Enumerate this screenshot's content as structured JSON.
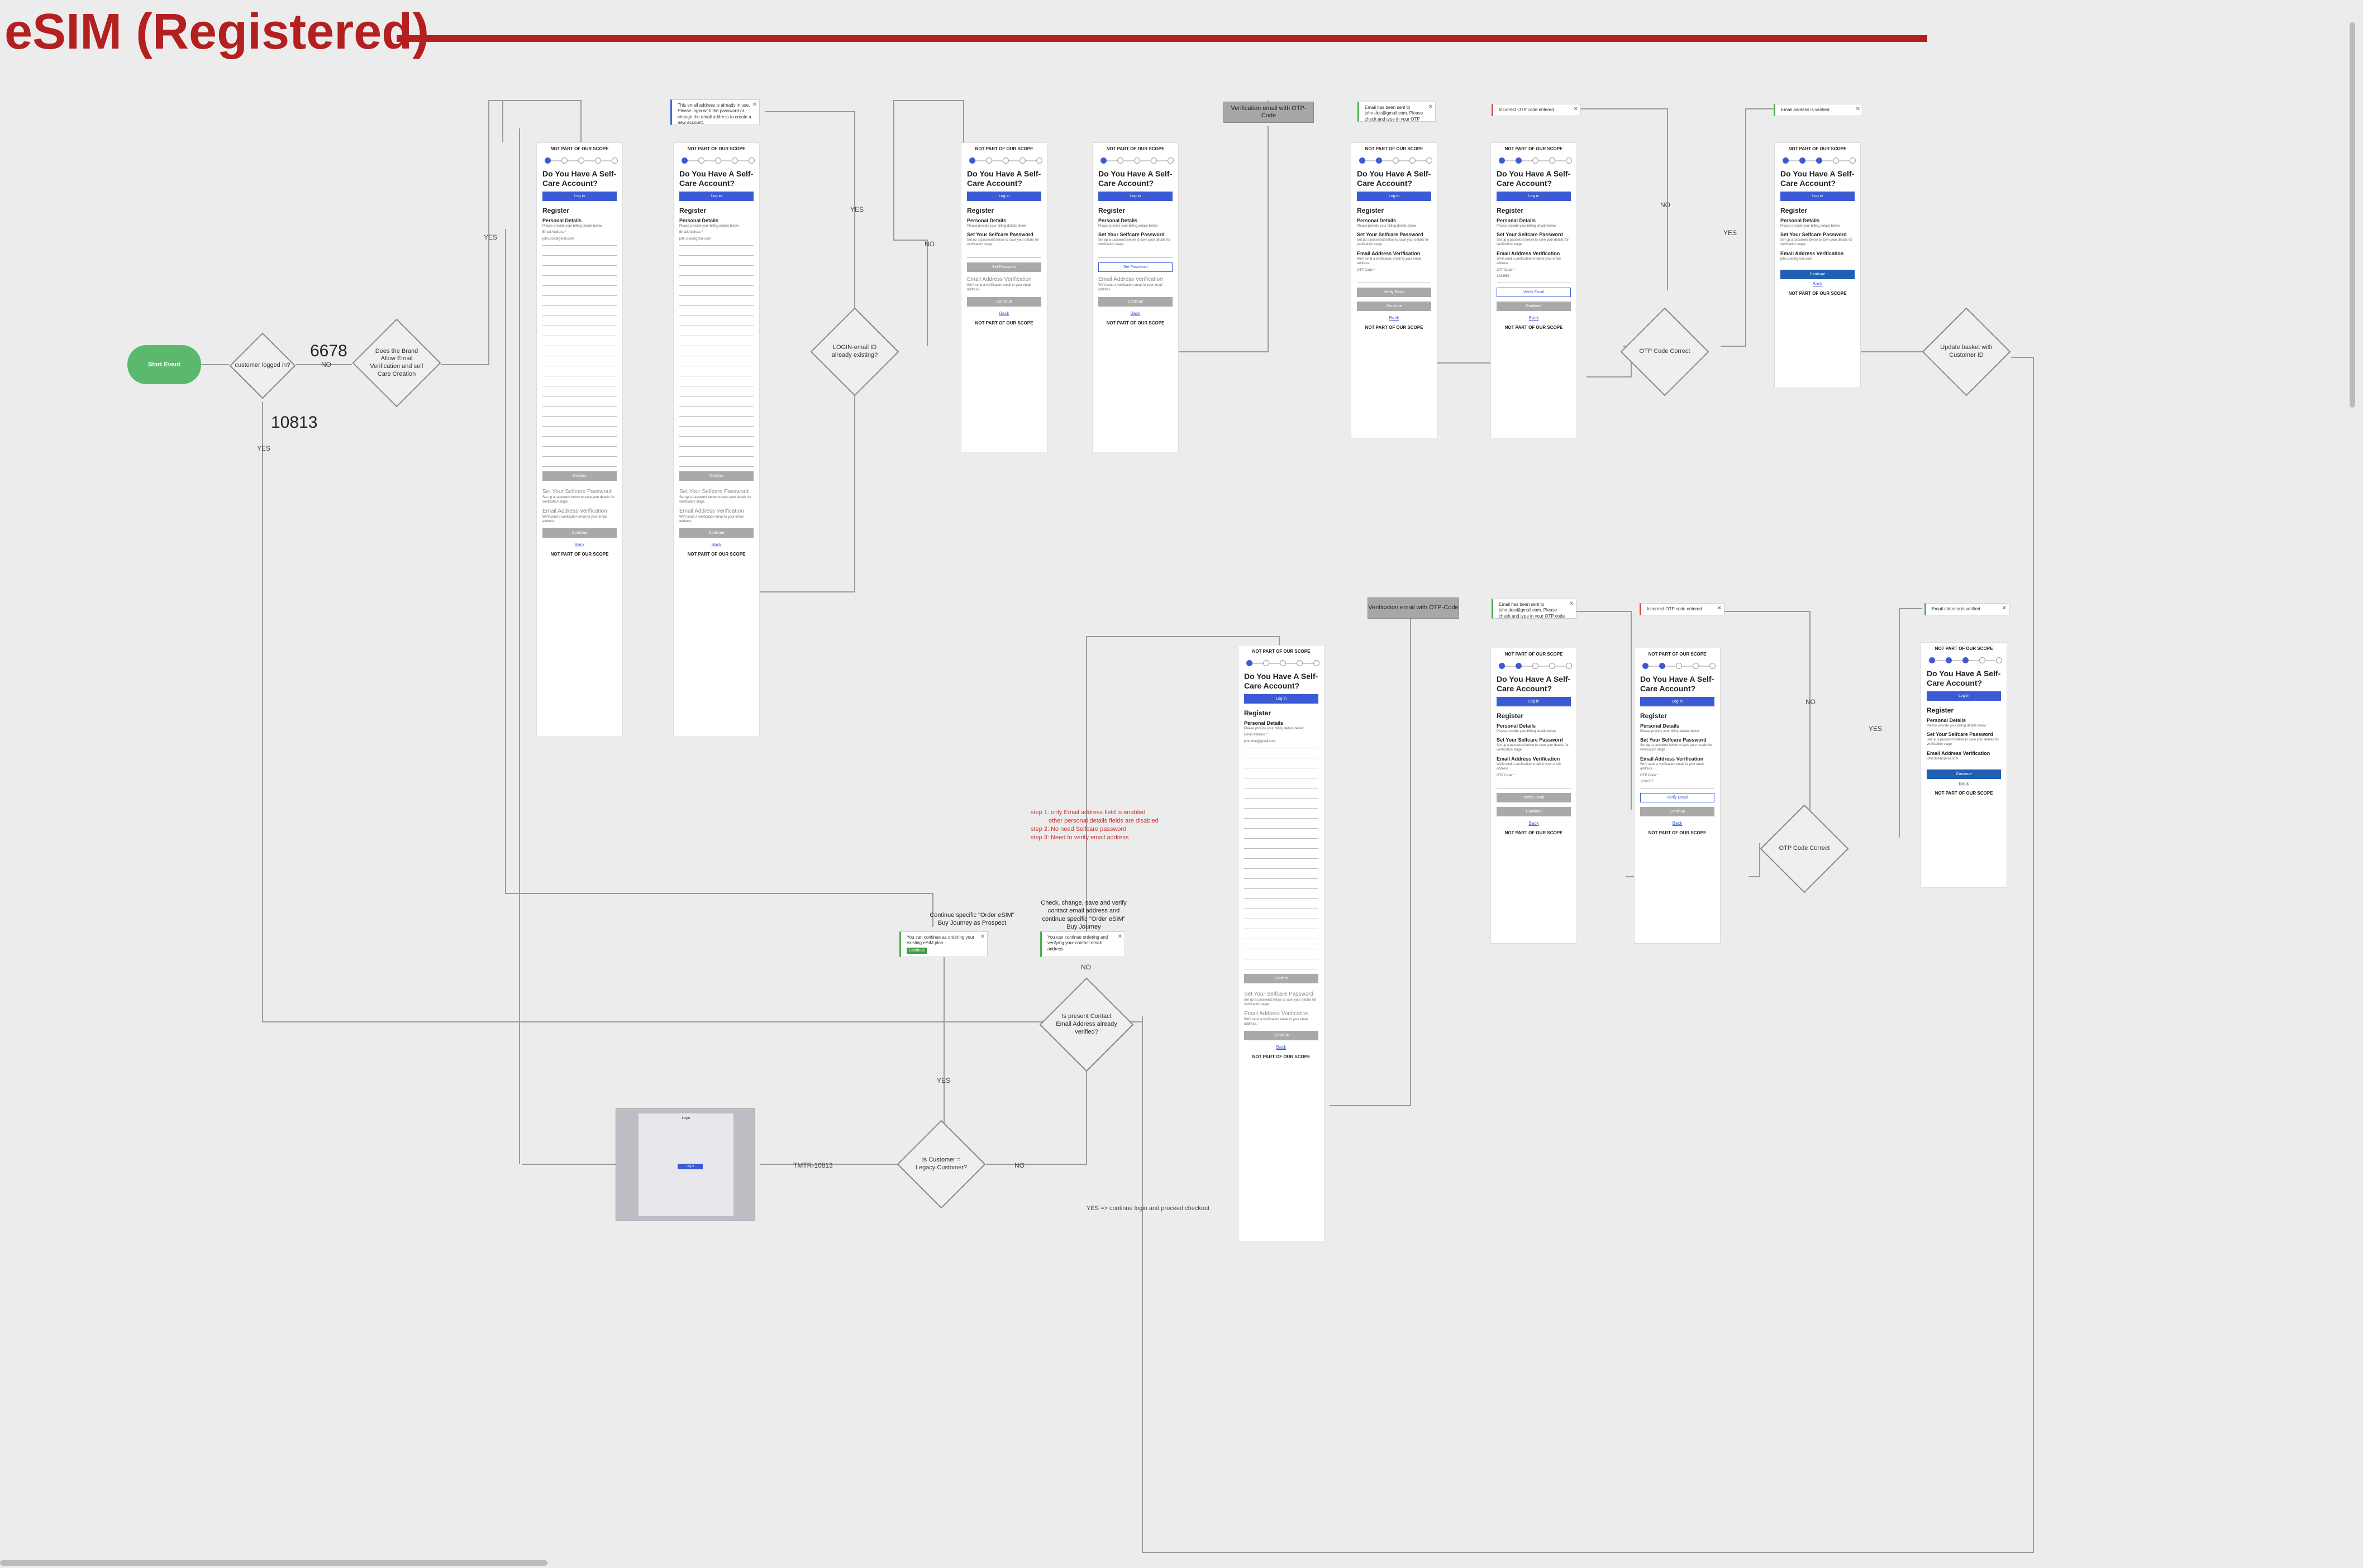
{
  "page": {
    "title": "eSIM (Registered)"
  },
  "nodes": {
    "start": "Start Event",
    "logged_in": "customer logged in?",
    "allow_email": "Does the Brand Allow Email Verification and self Care Creation",
    "login_email": "LOGIN-email ID already existing?",
    "otp_correct_1": "OTP Code Correct",
    "update_basket": "Update basket with Customer ID",
    "otp_correct_2": "OTP Code Correct",
    "contact_verified": "Is present Contact Email Address already verified?",
    "legacy_customer": "Is Customer = Legacy Customer?"
  },
  "labels": {
    "yes": "YES",
    "no": "NO",
    "count_6678": "6678",
    "count_10813": "10813",
    "tmtr": "TMTR-10813",
    "continue_checkout": "YES => continue login and proceed checkout",
    "continue_prospect": "Continue specific \"Order eSIM\" Buy Journey as Prospect",
    "check_change": "Check, change, save and verify contact email address and continue specific \"Order eSIM\" Buy Journey"
  },
  "red_notes": [
    "step 1: only Email address field is enabled",
    "other personal details fields are disabled",
    "step 2: No need Selfcare password",
    "step 3: Need to verify email address"
  ],
  "grey_boxes": {
    "verify_email_1": "Verification email with OTP-Code",
    "verify_email_2": "Verification email with OTP-Code"
  },
  "toasts": {
    "t1": "This email address is already in use. Please login with the password or change the email address to create a new account.",
    "t2": "Email has been sent to john.doe@gmail.com. Please check and type in your OTP code below.",
    "t3": "Incorrect OTP code entered",
    "t4": "Email address is verified",
    "t5": "Email has been sent to john.doe@gmail.com. Please check and type in your OTP code below.",
    "t6": "Incorrect OTP code entered",
    "t7": "Email address is verified",
    "t8": "You can continue as ordering your existing eSIM plan",
    "t8_btn": "Continue",
    "t9": "You can continue ordering and verifying your contact email address"
  },
  "frame": {
    "scope": "NOT PART OF OUR SCOPE",
    "heading": "Do You Have A Self-Care Account?",
    "login": "Log in",
    "register": "Register",
    "personal": "Personal Details",
    "personal_sub": "Please provide your billing details below",
    "password": "Set Your Selfcare Password",
    "password_sub": "Set up a password below to save your details for verification stage.",
    "email_verif": "Email Address Verification",
    "email_sub": "We'll send a verification email to your email address.",
    "confirm": "Confirm",
    "continue": "Continue",
    "back": "Back",
    "set_password": "Set Password",
    "verify_email": "Verify Email",
    "email_label": "Email Address *",
    "email_value": "john.doe@gmail.com",
    "otp_label": "OTP Code *",
    "otp_value": "1234567"
  },
  "legacy": {
    "title": "Login",
    "tab": "Log in"
  }
}
